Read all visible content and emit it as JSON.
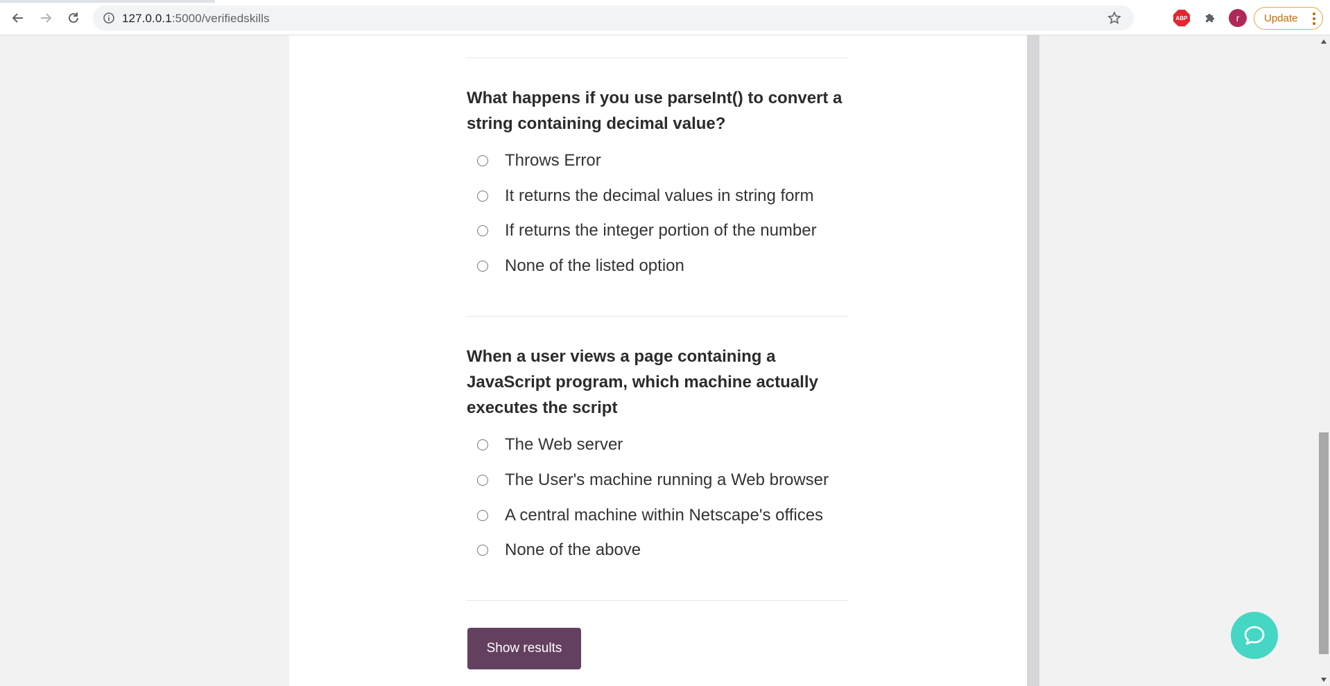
{
  "browser": {
    "url_host": "127.0.0.1",
    "url_path": ":5000/verifiedskills",
    "extension_abp_label": "ABP",
    "profile_initial": "r",
    "update_label": "Update"
  },
  "quiz": {
    "questions": [
      {
        "text": "What happens if you use parseInt() to convert a string containing decimal value?",
        "options": [
          "Throws Error",
          "It returns the decimal values in string form",
          "If returns the integer portion of the number",
          "None of the listed option"
        ]
      },
      {
        "text": "When a user views a page containing a JavaScript program, which machine actually executes the script",
        "options": [
          "The Web server",
          "The User's machine running a Web browser",
          "A central machine within Netscape's offices",
          "None of the above"
        ]
      }
    ],
    "submit_label": "Show results"
  },
  "colors": {
    "submit_button": "#63405f",
    "chat_button": "#45d6c4",
    "avatar": "#b0285a",
    "update_accent": "#c26a00"
  }
}
